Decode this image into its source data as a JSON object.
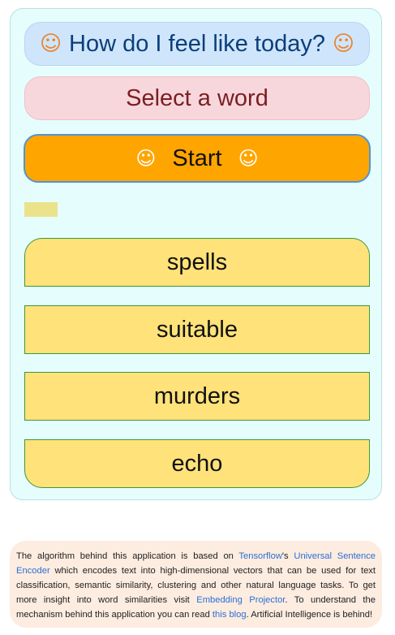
{
  "header": {
    "title": "How do I feel like today?",
    "left_icon": "smile-icon",
    "right_icon": "smile-icon",
    "icon_glyph": "☺"
  },
  "prompt": {
    "label": "Select a word"
  },
  "start": {
    "label": "Start",
    "icon_glyph": "☺"
  },
  "words": [
    {
      "label": "spells"
    },
    {
      "label": "suitable"
    },
    {
      "label": "murders"
    },
    {
      "label": "echo"
    }
  ],
  "footer": {
    "text_1": "The algorithm behind this application is based on ",
    "link_tensorflow": "Tensorflow",
    "text_2": "'s ",
    "link_use": "Universal Sentence Encoder",
    "text_3": " which encodes text into high-dimensional vectors that can be used for text classification, semantic similarity, clustering and other natural language tasks. To get more insight into word similarities visit ",
    "link_projector": "Embedding Projector",
    "text_4": ". To understand the mechanism behind this application you can read ",
    "link_blog": "this blog",
    "text_5": ". Artificial Intelligence is behind!"
  },
  "colors": {
    "panel_bg": "#e6fdfd",
    "title_bg": "#cfe5fb",
    "title_text": "#0b3f7a",
    "select_bg": "#f8d7dc",
    "select_text": "#7a1f22",
    "start_bg": "#ffa500",
    "word_bg": "#ffe27a",
    "footer_bg": "#fdece0",
    "link": "#2b6fd6"
  }
}
